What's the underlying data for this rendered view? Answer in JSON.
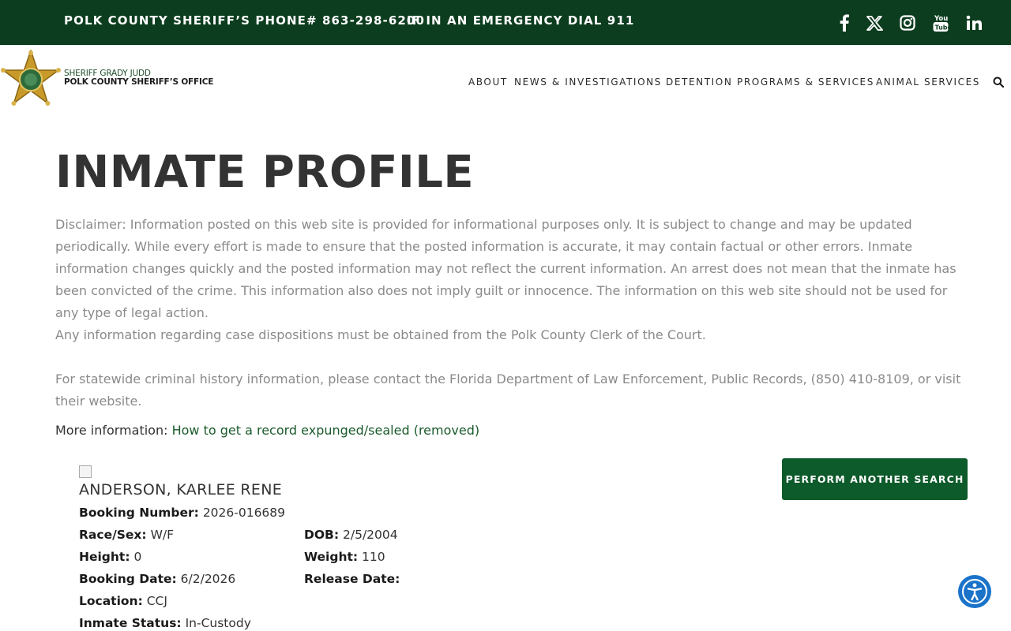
{
  "topbar": {
    "phone_text": "POLK COUNTY SHERIFF’S PHONE# 863-298-6200",
    "emergency_text": "IF IN AN EMERGENCY DIAL 911",
    "social": [
      "facebook-icon",
      "x-icon",
      "instagram-icon",
      "youtube-icon",
      "linkedin-icon"
    ]
  },
  "header": {
    "brand_line1": "SHERIFF GRADY JUDD",
    "brand_line2": "POLK COUNTY SHERIFF’S OFFICE",
    "nav": [
      "ABOUT",
      "NEWS & INVESTIGATIONS",
      "DETENTION",
      "PROGRAMS & SERVICES",
      "ANIMAL SERVICES"
    ]
  },
  "page": {
    "title": "INMATE PROFILE",
    "disclaimer_1": "Disclaimer: Information posted on this web site is provided for informational purposes only. It is subject to change and may be updated periodically. While every effort is made to ensure that the posted information is accurate, it may contain factual or other errors. Inmate information changes quickly and the posted information may not reflect the current information. An arrest does not mean that the inmate has been convicted of the crime. This information also does not imply guilt or innocence.  The information on this web site should not be used for any type of legal action.",
    "disclaimer_2": "Any information regarding case dispositions must be obtained from the Polk County Clerk of the Court.",
    "disclaimer_3": "For statewide criminal history information, please contact the Florida Department of Law Enforcement, Public Records, (850) 410-8109, or visit their website.",
    "more_label": "More information:",
    "more_link": "How to get a record expunged/sealed (removed)",
    "search_button": "PERFORM ANOTHER SEARCH"
  },
  "inmate": {
    "name": "ANDERSON, KARLEE RENE",
    "booking_number_label": "Booking Number:",
    "booking_number": "2026-016689",
    "race_sex_label": "Race/Sex:",
    "race_sex": "W/F",
    "dob_label": "DOB:",
    "dob": "2/5/2004",
    "height_label": "Height:",
    "height": "0",
    "weight_label": "Weight:",
    "weight": "110",
    "booking_date_label": "Booking Date:",
    "booking_date": "6/2/2026",
    "release_date_label": "Release Date:",
    "release_date": "",
    "location_label": "Location:",
    "location": "CCJ",
    "status_label": "Inmate Status:",
    "status": "In-Custody"
  },
  "colors": {
    "topbar_bg": "#0d3d1f",
    "button_bg": "#0d5a2a",
    "link": "#1a5a2c",
    "accessibility": "#1a73c9"
  }
}
